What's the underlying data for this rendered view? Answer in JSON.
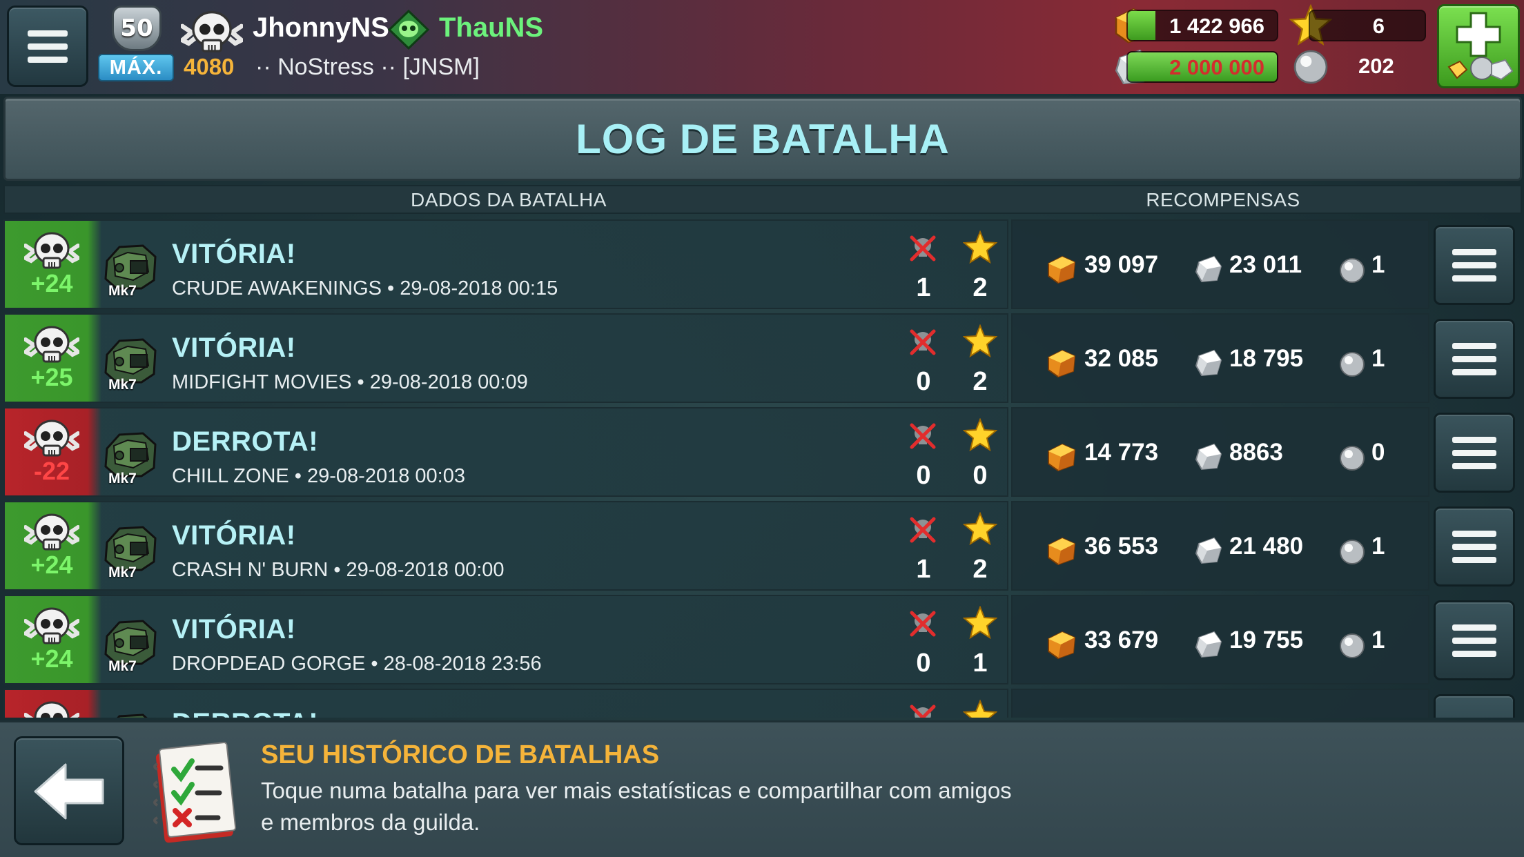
{
  "player": {
    "level": "50",
    "level_badge": "MÁX.",
    "trophies": "4080",
    "name": "JhonnyNS",
    "guild_name": "ThauNS",
    "guild_tag": "·· NoStress ·· [JNSM]"
  },
  "resources": {
    "gold": "1 422 966",
    "silver": "2 000 000",
    "stars": "6",
    "pearls": "202"
  },
  "title": "LOG DE BATALHA",
  "columns": {
    "battle_data": "DADOS DA BATALHA",
    "rewards": "RECOMPENSAS"
  },
  "battles": [
    {
      "outcome": "win",
      "trophies": "+24",
      "robot_tag": "Mk7",
      "result": "VITÓRIA!",
      "details": "CRUDE AWAKENINGS • 29-08-2018 00:15",
      "kills": "1",
      "stars": "2",
      "gold": "39 097",
      "silver": "23 011",
      "pearls": "1"
    },
    {
      "outcome": "win",
      "trophies": "+25",
      "robot_tag": "Mk7",
      "result": "VITÓRIA!",
      "details": "MIDFIGHT MOVIES • 29-08-2018 00:09",
      "kills": "0",
      "stars": "2",
      "gold": "32 085",
      "silver": "18 795",
      "pearls": "1"
    },
    {
      "outcome": "loss",
      "trophies": "-22",
      "robot_tag": "Mk7",
      "result": "DERROTA!",
      "details": "CHILL ZONE • 29-08-2018 00:03",
      "kills": "0",
      "stars": "0",
      "gold": "14 773",
      "silver": "8863",
      "pearls": "0"
    },
    {
      "outcome": "win",
      "trophies": "+24",
      "robot_tag": "Mk7",
      "result": "VITÓRIA!",
      "details": "CRASH N' BURN • 29-08-2018 00:00",
      "kills": "1",
      "stars": "2",
      "gold": "36 553",
      "silver": "21 480",
      "pearls": "1"
    },
    {
      "outcome": "win",
      "trophies": "+24",
      "robot_tag": "Mk7",
      "result": "VITÓRIA!",
      "details": "DROPDEAD GORGE • 28-08-2018 23:56",
      "kills": "0",
      "stars": "1",
      "gold": "33 679",
      "silver": "19 755",
      "pearls": "1"
    },
    {
      "outcome": "loss",
      "trophies": "",
      "robot_tag": "",
      "result": "DERROTA!",
      "details": "",
      "kills": "",
      "stars": "",
      "gold": "",
      "silver": "",
      "pearls": ""
    }
  ],
  "footer": {
    "title": "SEU HISTÓRICO DE BATALHAS",
    "text": "Toque numa batalha para ver mais estatísticas e compartilhar com amigos e membros da guilda."
  },
  "icons": {
    "menu": "hamburger-icon",
    "skull": "skull-icon",
    "guild": "guild-emblem-icon",
    "gold": "gold-icon",
    "silver": "silver-icon",
    "star": "star-icon",
    "pearl": "pearl-icon",
    "shop": "shop-plus-icon",
    "robot": "robot-icon",
    "kills": "kills-cross-icon",
    "back": "back-arrow-icon",
    "history": "checklist-book-icon"
  },
  "colors": {
    "win": "#3d9a2e",
    "loss": "#b8242a",
    "title": "#a8f0f6",
    "accent_gold": "#f5b43a",
    "guild_green": "#6cf27c"
  }
}
